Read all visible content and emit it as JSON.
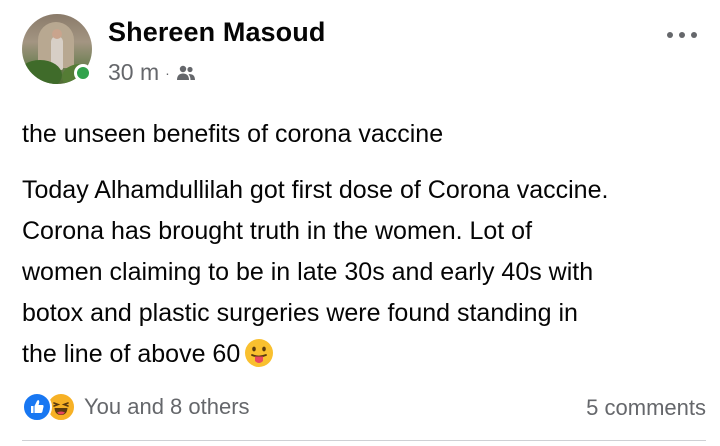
{
  "post": {
    "author": "Shereen Masoud",
    "time": "30 m",
    "separator": "·",
    "audience_icon": "friends-icon",
    "title": "the unseen benefits of corona vaccine",
    "body_lines": [
      "Today Alhamdullilah got first dose of Corona vaccine.",
      "Corona has brought truth in the women. Lot of",
      "women claiming to be in late 30s and early 40s with",
      "botox and plastic surgeries were found  standing in",
      "the line of above 60"
    ],
    "trailing_emoji": "tongue-out-emoji"
  },
  "footer": {
    "reaction_icons": [
      "like-reaction-icon",
      "haha-reaction-icon"
    ],
    "reactions_text": "You and 8 others",
    "comments_text": "5 comments"
  },
  "colors": {
    "text_primary": "#050505",
    "text_secondary": "#65676b",
    "online": "#31a24c",
    "like_blue": "#1877f2",
    "haha_yellow": "#f7b125"
  }
}
